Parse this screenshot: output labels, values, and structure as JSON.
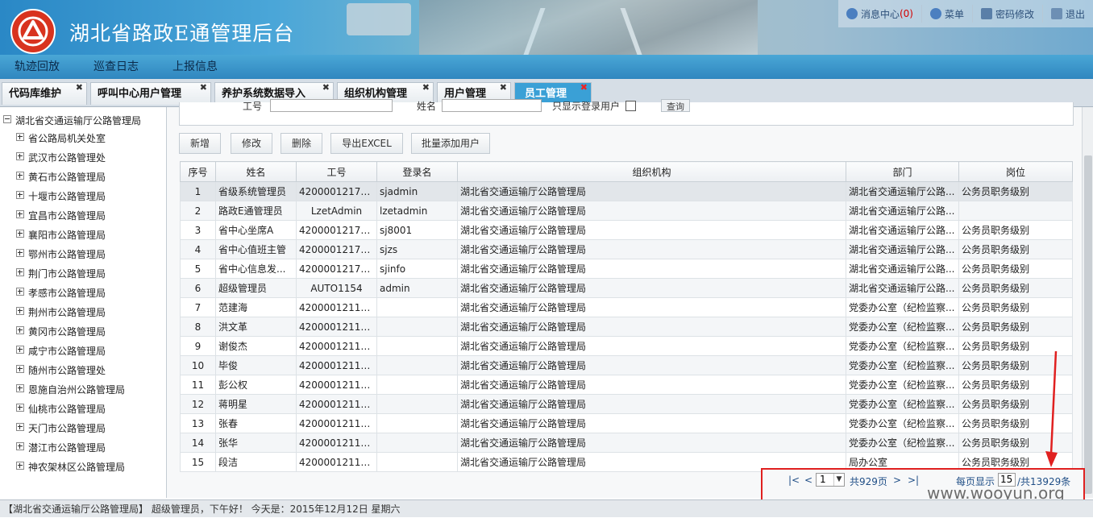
{
  "header": {
    "title": "湖北省路政E通管理后台",
    "links": [
      {
        "icon": "message-icon",
        "label": "消息中心",
        "count": "(0)"
      },
      {
        "icon": "menu-icon",
        "label": "菜单"
      },
      {
        "icon": "lock-icon",
        "label": "密码修改"
      },
      {
        "icon": "logout-icon",
        "label": "退出"
      }
    ]
  },
  "nav": [
    "轨迹回放",
    "巡查日志",
    "上报信息"
  ],
  "tabs": [
    {
      "label": "代码库维护"
    },
    {
      "label": "呼叫中心用户管理"
    },
    {
      "label": "养护系统数据导入"
    },
    {
      "label": "组织机构管理"
    },
    {
      "label": "用户管理"
    },
    {
      "label": "员工管理",
      "active": true
    }
  ],
  "tree": {
    "root": "湖北省交通运输厅公路管理局",
    "nodes": [
      "省公路局机关处室",
      "武汉市公路管理处",
      "黄石市公路管理局",
      "十堰市公路管理局",
      "宜昌市公路管理局",
      "襄阳市公路管理局",
      "鄂州市公路管理局",
      "荆门市公路管理局",
      "孝感市公路管理局",
      "荆州市公路管理局",
      "黄冈市公路管理局",
      "咸宁市公路管理局",
      "随州市公路管理处",
      "恩施自治州公路管理局",
      "仙桃市公路管理局",
      "天门市公路管理局",
      "潜江市公路管理局",
      "神农架林区公路管理局"
    ]
  },
  "search": {
    "labels": [
      "工号",
      "姓名",
      "只显示登录用户"
    ],
    "query_button": "查询"
  },
  "toolbar": [
    "新增",
    "修改",
    "删除",
    "导出EXCEL",
    "批量添加用户"
  ],
  "table": {
    "columns": [
      "序号",
      "姓名",
      "工号",
      "登录名",
      "组织机构",
      "部门",
      "岗位"
    ],
    "rows": [
      [
        "1",
        "省级系统管理员",
        "42000012170...",
        "sjadmin",
        "湖北省交通运输厅公路管理局",
        "湖北省交通运输厅公路...",
        "公务员职务级别"
      ],
      [
        "2",
        "路政E通管理员",
        "LzetAdmin",
        "lzetadmin",
        "湖北省交通运输厅公路管理局",
        "湖北省交通运输厅公路...",
        ""
      ],
      [
        "3",
        "省中心坐席A",
        "42000012170...",
        "sj8001",
        "湖北省交通运输厅公路管理局",
        "湖北省交通运输厅公路...",
        "公务员职务级别"
      ],
      [
        "4",
        "省中心值班主管",
        "42000012170...",
        "sjzs",
        "湖北省交通运输厅公路管理局",
        "湖北省交通运输厅公路...",
        "公务员职务级别"
      ],
      [
        "5",
        "省中心信息发...",
        "42000012170...",
        "sjinfo",
        "湖北省交通运输厅公路管理局",
        "湖北省交通运输厅公路...",
        "公务员职务级别"
      ],
      [
        "6",
        "超级管理员",
        "AUTO1154",
        "admin",
        "湖北省交通运输厅公路管理局",
        "湖北省交通运输厅公路...",
        "公务员职务级别"
      ],
      [
        "7",
        "范建海",
        "42000012110...",
        "",
        "湖北省交通运输厅公路管理局",
        "党委办公室（纪检监察...",
        "公务员职务级别"
      ],
      [
        "8",
        "洪文革",
        "42000012110...",
        "",
        "湖北省交通运输厅公路管理局",
        "党委办公室（纪检监察...",
        "公务员职务级别"
      ],
      [
        "9",
        "谢俊杰",
        "42000012110...",
        "",
        "湖北省交通运输厅公路管理局",
        "党委办公室（纪检监察...",
        "公务员职务级别"
      ],
      [
        "10",
        "毕俊",
        "42000012110...",
        "",
        "湖北省交通运输厅公路管理局",
        "党委办公室（纪检监察...",
        "公务员职务级别"
      ],
      [
        "11",
        "彭公权",
        "42000012110...",
        "",
        "湖北省交通运输厅公路管理局",
        "党委办公室（纪检监察...",
        "公务员职务级别"
      ],
      [
        "12",
        "蒋明星",
        "42000012110...",
        "",
        "湖北省交通运输厅公路管理局",
        "党委办公室（纪检监察...",
        "公务员职务级别"
      ],
      [
        "13",
        "张春",
        "42000012110...",
        "",
        "湖北省交通运输厅公路管理局",
        "党委办公室（纪检监察...",
        "公务员职务级别"
      ],
      [
        "14",
        "张华",
        "42000012110...",
        "",
        "湖北省交通运输厅公路管理局",
        "党委办公室（纪检监察...",
        "公务员职务级别"
      ],
      [
        "15",
        "段洁",
        "42000012110...",
        "",
        "湖北省交通运输厅公路管理局",
        "局办公室",
        "公务员职务级别"
      ]
    ]
  },
  "pager": {
    "first": "|<",
    "prev": "<",
    "page": "1",
    "total_pages": "共929页",
    "next": ">",
    "last": ">|",
    "per_page_label": "每页显示",
    "per_page": "15",
    "total": "/共13929条"
  },
  "watermark": "www.wooyun.org",
  "status": "【湖北省交通运输厅公路管理局】 超级管理员，下午好！ 今天是：2015年12月12日 星期六",
  "colors": {
    "accent": "#3aa0d6",
    "highlight": "#e02020"
  }
}
